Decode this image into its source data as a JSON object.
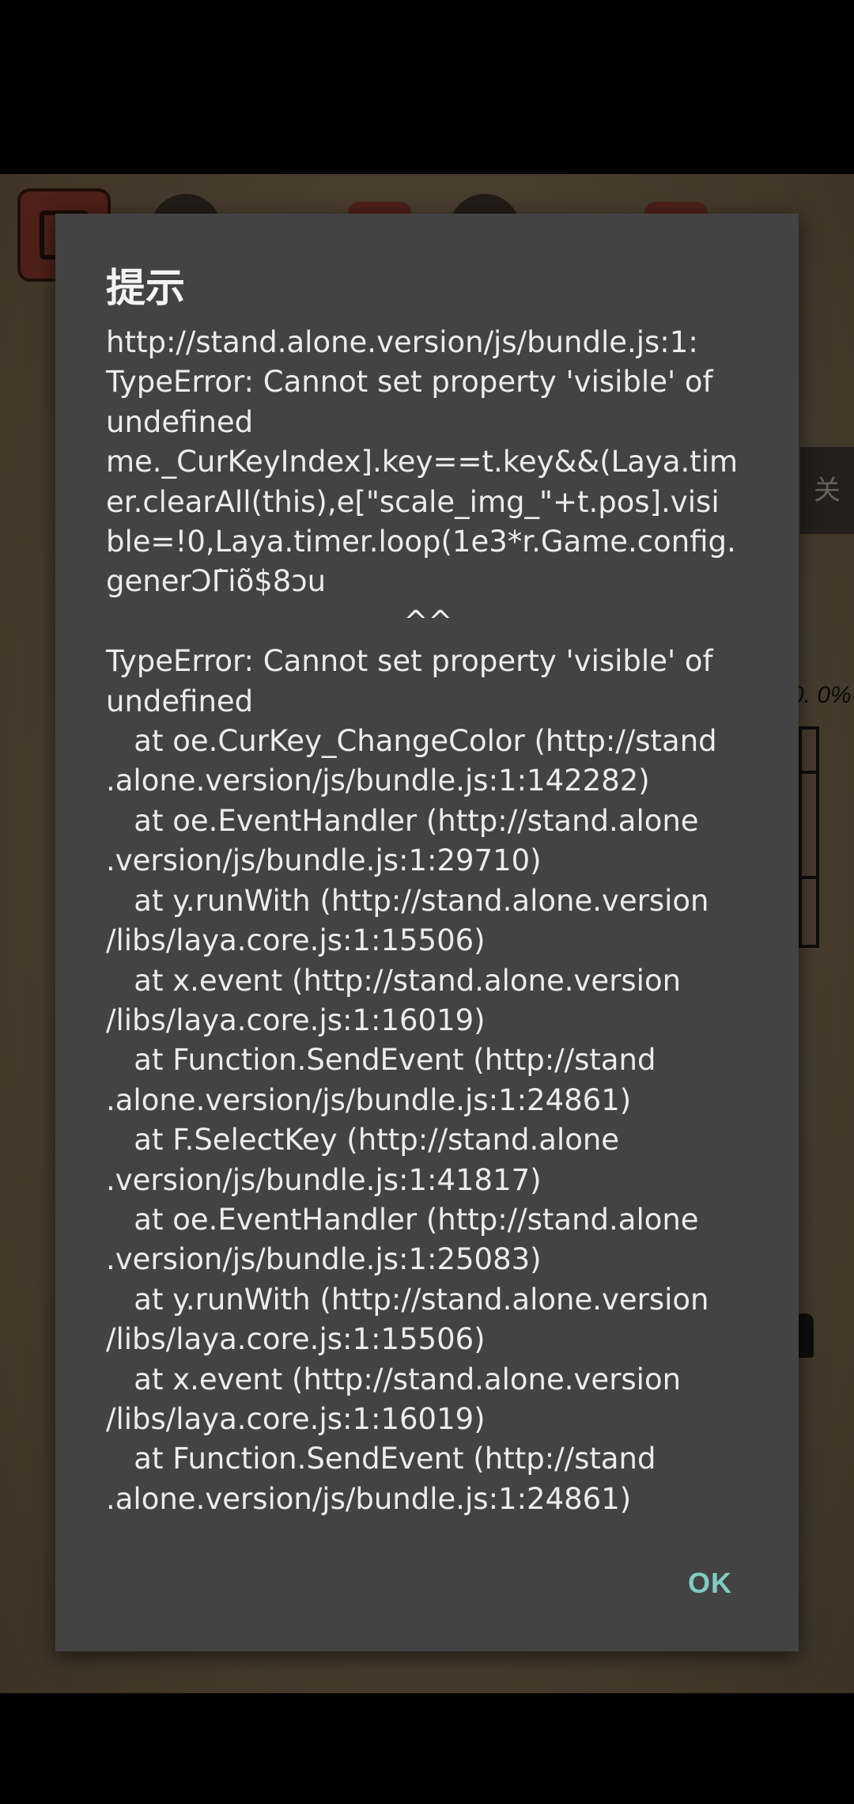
{
  "dialog": {
    "title": "提示",
    "message": "http://stand.alone.version/js/bundle.js:1:\nTypeError: Cannot set property 'visible' of\nundefined\nme._CurKeyIndex].key==t.key&&(Laya.tim\ner.clearAll(this),e[\"scale_img_\"+t.pos].visi\nble=!0,Laya.timer.loop(1e3*r.Game.config.\ngenerϽΓ̇iõ$8ɔu\n                                ^^\nTypeError: Cannot set property 'visible' of\nundefined\n   at oe.CurKey_ChangeColor (http://stand\n.alone.version/js/bundle.js:1:142282)\n   at oe.EventHandler (http://stand.alone\n.version/js/bundle.js:1:29710)\n   at y.runWith (http://stand.alone.version\n/libs/laya.core.js:1:15506)\n   at x.event (http://stand.alone.version\n/libs/laya.core.js:1:16019)\n   at Function.SendEvent (http://stand\n.alone.version/js/bundle.js:1:24861)\n   at F.SelectKey (http://stand.alone\n.version/js/bundle.js:1:41817)\n   at oe.EventHandler (http://stand.alone\n.version/js/bundle.js:1:25083)\n   at y.runWith (http://stand.alone.version\n/libs/laya.core.js:1:15506)\n   at x.event (http://stand.alone.version\n/libs/laya.core.js:1:16019)\n   at Function.SendEvent (http://stand\n.alone.version/js/bundle.js:1:24861)",
    "ok_label": "OK"
  },
  "background": {
    "side_tab_glyph": "关",
    "percent_text": "0. 0%"
  },
  "colors": {
    "dialog_bg": "#434343",
    "accent": "#80cbc4",
    "game_bg": "#857258"
  }
}
